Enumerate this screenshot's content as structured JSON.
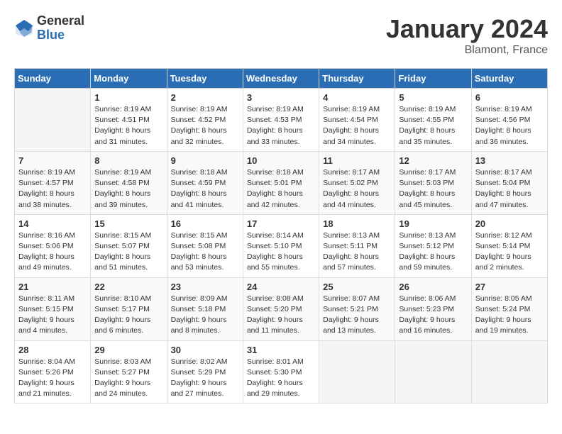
{
  "header": {
    "logo_general": "General",
    "logo_blue": "Blue",
    "month_title": "January 2024",
    "location": "Blamont, France"
  },
  "columns": [
    "Sunday",
    "Monday",
    "Tuesday",
    "Wednesday",
    "Thursday",
    "Friday",
    "Saturday"
  ],
  "weeks": [
    {
      "days": [
        {
          "num": "",
          "info": ""
        },
        {
          "num": "1",
          "info": "Sunrise: 8:19 AM\nSunset: 4:51 PM\nDaylight: 8 hours\nand 31 minutes."
        },
        {
          "num": "2",
          "info": "Sunrise: 8:19 AM\nSunset: 4:52 PM\nDaylight: 8 hours\nand 32 minutes."
        },
        {
          "num": "3",
          "info": "Sunrise: 8:19 AM\nSunset: 4:53 PM\nDaylight: 8 hours\nand 33 minutes."
        },
        {
          "num": "4",
          "info": "Sunrise: 8:19 AM\nSunset: 4:54 PM\nDaylight: 8 hours\nand 34 minutes."
        },
        {
          "num": "5",
          "info": "Sunrise: 8:19 AM\nSunset: 4:55 PM\nDaylight: 8 hours\nand 35 minutes."
        },
        {
          "num": "6",
          "info": "Sunrise: 8:19 AM\nSunset: 4:56 PM\nDaylight: 8 hours\nand 36 minutes."
        }
      ]
    },
    {
      "days": [
        {
          "num": "7",
          "info": "Sunrise: 8:19 AM\nSunset: 4:57 PM\nDaylight: 8 hours\nand 38 minutes."
        },
        {
          "num": "8",
          "info": "Sunrise: 8:19 AM\nSunset: 4:58 PM\nDaylight: 8 hours\nand 39 minutes."
        },
        {
          "num": "9",
          "info": "Sunrise: 8:18 AM\nSunset: 4:59 PM\nDaylight: 8 hours\nand 41 minutes."
        },
        {
          "num": "10",
          "info": "Sunrise: 8:18 AM\nSunset: 5:01 PM\nDaylight: 8 hours\nand 42 minutes."
        },
        {
          "num": "11",
          "info": "Sunrise: 8:17 AM\nSunset: 5:02 PM\nDaylight: 8 hours\nand 44 minutes."
        },
        {
          "num": "12",
          "info": "Sunrise: 8:17 AM\nSunset: 5:03 PM\nDaylight: 8 hours\nand 45 minutes."
        },
        {
          "num": "13",
          "info": "Sunrise: 8:17 AM\nSunset: 5:04 PM\nDaylight: 8 hours\nand 47 minutes."
        }
      ]
    },
    {
      "days": [
        {
          "num": "14",
          "info": "Sunrise: 8:16 AM\nSunset: 5:06 PM\nDaylight: 8 hours\nand 49 minutes."
        },
        {
          "num": "15",
          "info": "Sunrise: 8:15 AM\nSunset: 5:07 PM\nDaylight: 8 hours\nand 51 minutes."
        },
        {
          "num": "16",
          "info": "Sunrise: 8:15 AM\nSunset: 5:08 PM\nDaylight: 8 hours\nand 53 minutes."
        },
        {
          "num": "17",
          "info": "Sunrise: 8:14 AM\nSunset: 5:10 PM\nDaylight: 8 hours\nand 55 minutes."
        },
        {
          "num": "18",
          "info": "Sunrise: 8:13 AM\nSunset: 5:11 PM\nDaylight: 8 hours\nand 57 minutes."
        },
        {
          "num": "19",
          "info": "Sunrise: 8:13 AM\nSunset: 5:12 PM\nDaylight: 8 hours\nand 59 minutes."
        },
        {
          "num": "20",
          "info": "Sunrise: 8:12 AM\nSunset: 5:14 PM\nDaylight: 9 hours\nand 2 minutes."
        }
      ]
    },
    {
      "days": [
        {
          "num": "21",
          "info": "Sunrise: 8:11 AM\nSunset: 5:15 PM\nDaylight: 9 hours\nand 4 minutes."
        },
        {
          "num": "22",
          "info": "Sunrise: 8:10 AM\nSunset: 5:17 PM\nDaylight: 9 hours\nand 6 minutes."
        },
        {
          "num": "23",
          "info": "Sunrise: 8:09 AM\nSunset: 5:18 PM\nDaylight: 9 hours\nand 8 minutes."
        },
        {
          "num": "24",
          "info": "Sunrise: 8:08 AM\nSunset: 5:20 PM\nDaylight: 9 hours\nand 11 minutes."
        },
        {
          "num": "25",
          "info": "Sunrise: 8:07 AM\nSunset: 5:21 PM\nDaylight: 9 hours\nand 13 minutes."
        },
        {
          "num": "26",
          "info": "Sunrise: 8:06 AM\nSunset: 5:23 PM\nDaylight: 9 hours\nand 16 minutes."
        },
        {
          "num": "27",
          "info": "Sunrise: 8:05 AM\nSunset: 5:24 PM\nDaylight: 9 hours\nand 19 minutes."
        }
      ]
    },
    {
      "days": [
        {
          "num": "28",
          "info": "Sunrise: 8:04 AM\nSunset: 5:26 PM\nDaylight: 9 hours\nand 21 minutes."
        },
        {
          "num": "29",
          "info": "Sunrise: 8:03 AM\nSunset: 5:27 PM\nDaylight: 9 hours\nand 24 minutes."
        },
        {
          "num": "30",
          "info": "Sunrise: 8:02 AM\nSunset: 5:29 PM\nDaylight: 9 hours\nand 27 minutes."
        },
        {
          "num": "31",
          "info": "Sunrise: 8:01 AM\nSunset: 5:30 PM\nDaylight: 9 hours\nand 29 minutes."
        },
        {
          "num": "",
          "info": ""
        },
        {
          "num": "",
          "info": ""
        },
        {
          "num": "",
          "info": ""
        }
      ]
    }
  ]
}
